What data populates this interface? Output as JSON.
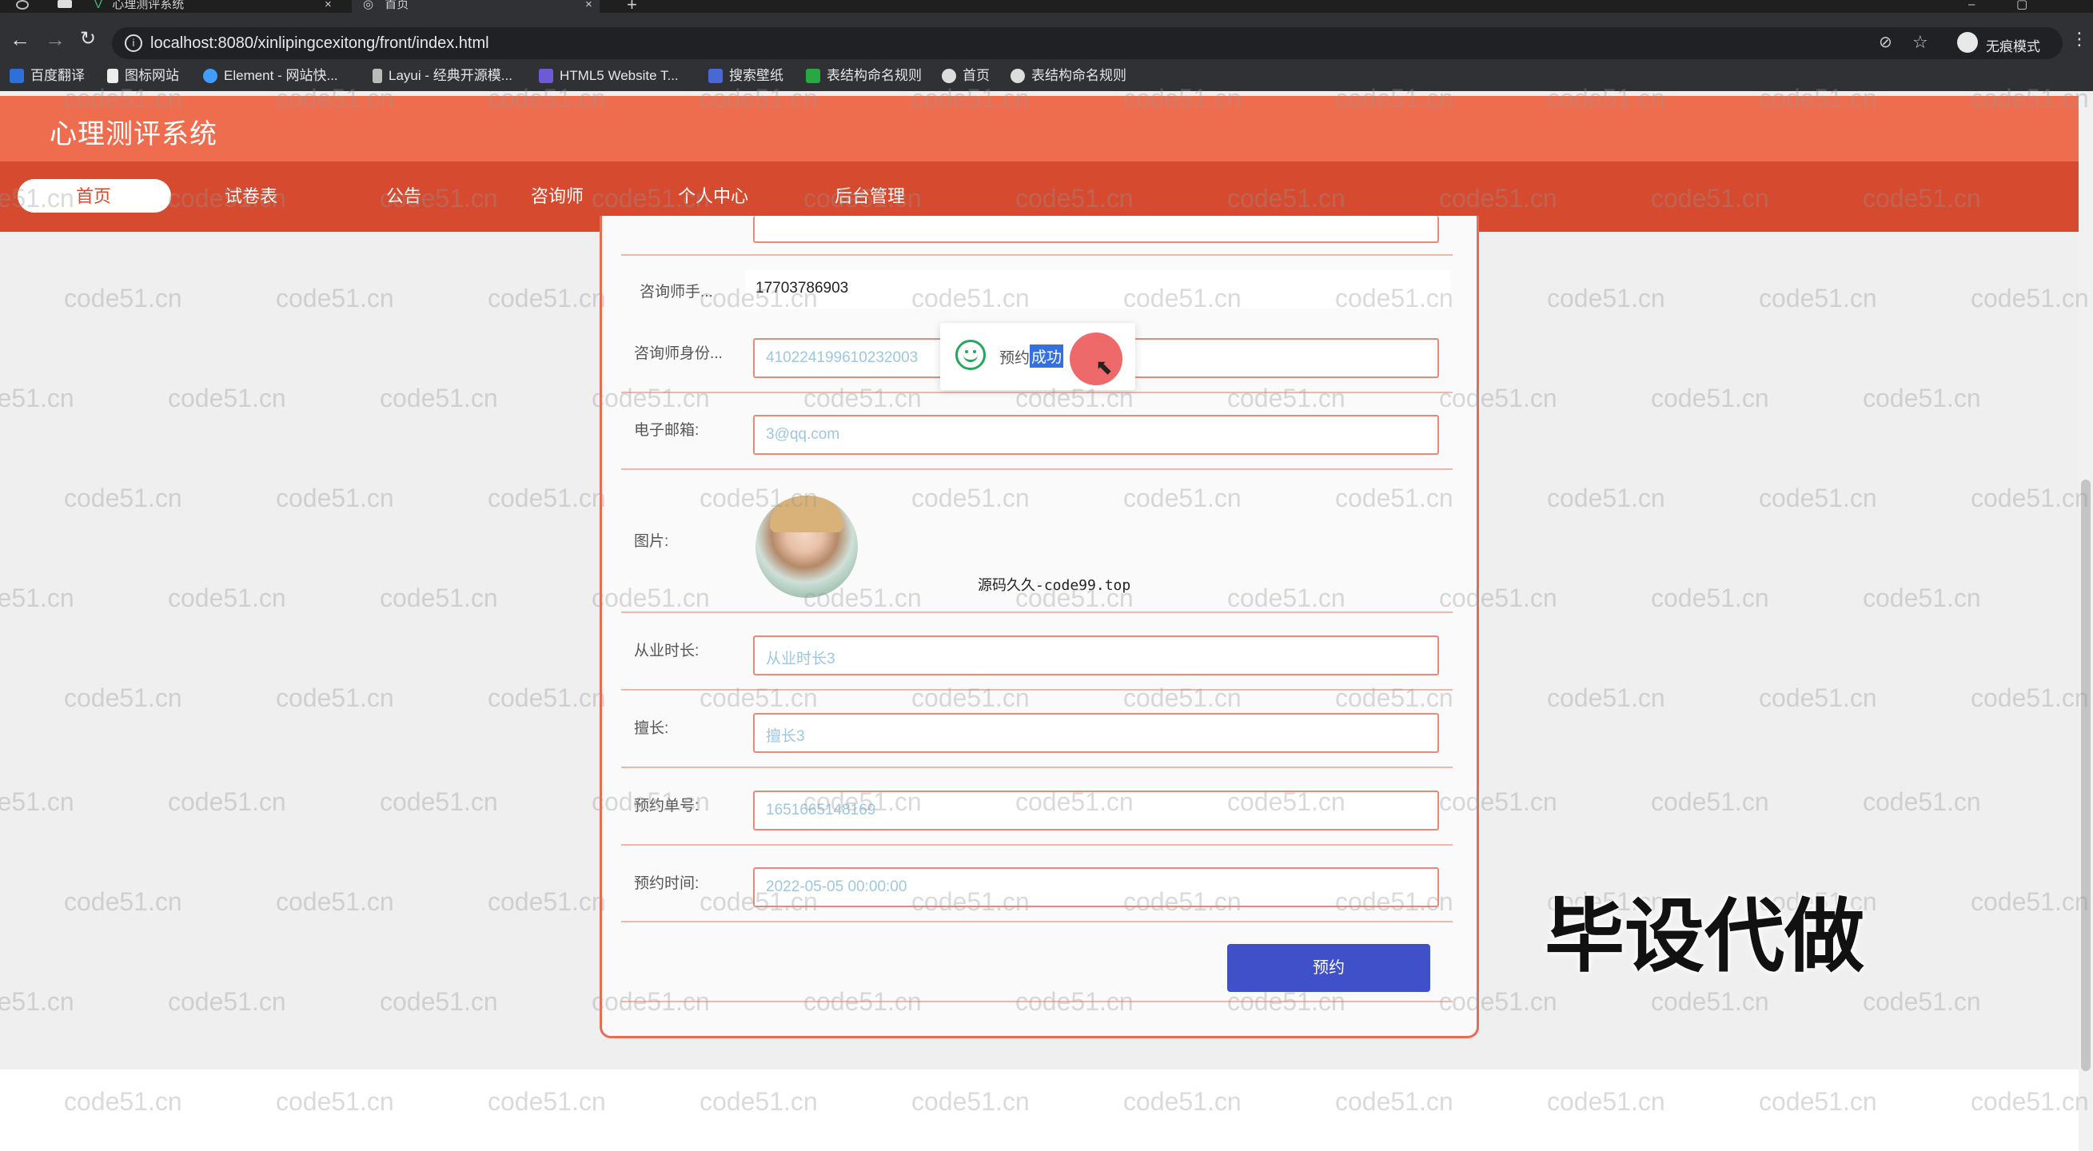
{
  "browser": {
    "tabs": [
      {
        "label": "心理测评系统"
      },
      {
        "label": "首页"
      }
    ],
    "address": "localhost:8080/xinlipingcexitong/front/index.html",
    "profile_label": "无痕模式",
    "bookmarks": [
      {
        "label": "百度翻译"
      },
      {
        "label": "图标网站"
      },
      {
        "label": "Element - 网站快..."
      },
      {
        "label": "Layui - 经典开源模..."
      },
      {
        "label": "HTML5 Website T..."
      },
      {
        "label": "搜索壁纸"
      },
      {
        "label": "表结构命名规则"
      },
      {
        "label": "首页"
      },
      {
        "label": "表结构命名规则"
      }
    ]
  },
  "site": {
    "title": "心理测评系统",
    "nav": [
      {
        "label": "首页"
      },
      {
        "label": "试卷表"
      },
      {
        "label": "公告"
      },
      {
        "label": "咨询师"
      },
      {
        "label": "个人中心"
      },
      {
        "label": "后台管理"
      }
    ]
  },
  "form": {
    "phone_label": "咨询师手...",
    "phone_value": "17703786903",
    "id_label": "咨询师身份...",
    "id_value": "410224199610232003",
    "email_label": "电子邮箱:",
    "email_value": "3@qq.com",
    "photo_label": "图片:",
    "years_label": "从业时长:",
    "years_value": "从业时长3",
    "specialty_label": "擅长:",
    "specialty_value": "擅长3",
    "order_no_label": "预约单号:",
    "order_no_value": "1651665148169",
    "time_label": "预约时间:",
    "time_value": "2022-05-05 00:00:00",
    "submit_label": "预约"
  },
  "toast": {
    "text_a": "预约",
    "text_b": "成功"
  },
  "overlay": {
    "source_text": "源码久久-code99.top",
    "ad_text": "毕设代做",
    "watermark": "code51.cn"
  },
  "colors": {
    "header_light": "#ee6d4f",
    "header_dark": "#d64b2f",
    "submit_button": "#4050c8",
    "toast_icon": "#26a65b"
  }
}
